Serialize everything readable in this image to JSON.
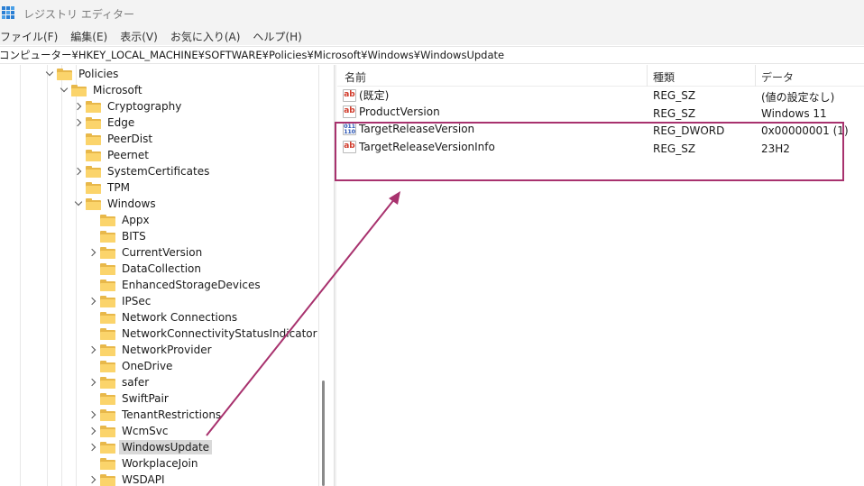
{
  "window": {
    "title": "レジストリ エディター"
  },
  "menu": [
    "ファイル(F)",
    "編集(E)",
    "表示(V)",
    "お気に入り(A)",
    "ヘルプ(H)"
  ],
  "address": "コンピューター¥HKEY_LOCAL_MACHINE¥SOFTWARE¥Policies¥Microsoft¥Windows¥WindowsUpdate",
  "tree": [
    {
      "label": "Policies",
      "expander": "down"
    },
    {
      "label": "Microsoft",
      "expander": "down"
    },
    {
      "label": "Cryptography",
      "expander": "right"
    },
    {
      "label": "Edge",
      "expander": "right"
    },
    {
      "label": "PeerDist",
      "expander": "none"
    },
    {
      "label": "Peernet",
      "expander": "none"
    },
    {
      "label": "SystemCertificates",
      "expander": "right"
    },
    {
      "label": "TPM",
      "expander": "none"
    },
    {
      "label": "Windows",
      "expander": "down"
    },
    {
      "label": "Appx",
      "expander": "none"
    },
    {
      "label": "BITS",
      "expander": "none"
    },
    {
      "label": "CurrentVersion",
      "expander": "right"
    },
    {
      "label": "DataCollection",
      "expander": "none"
    },
    {
      "label": "EnhancedStorageDevices",
      "expander": "none"
    },
    {
      "label": "IPSec",
      "expander": "right"
    },
    {
      "label": "Network Connections",
      "expander": "none"
    },
    {
      "label": "NetworkConnectivityStatusIndicator",
      "expander": "none"
    },
    {
      "label": "NetworkProvider",
      "expander": "right"
    },
    {
      "label": "OneDrive",
      "expander": "none"
    },
    {
      "label": "safer",
      "expander": "right"
    },
    {
      "label": "SwiftPair",
      "expander": "none"
    },
    {
      "label": "TenantRestrictions",
      "expander": "right"
    },
    {
      "label": "WcmSvc",
      "expander": "right"
    },
    {
      "label": "WindowsUpdate",
      "expander": "right",
      "selected": true
    },
    {
      "label": "WorkplaceJoin",
      "expander": "none"
    },
    {
      "label": "WSDAPI",
      "expander": "right"
    }
  ],
  "list": {
    "columns": [
      "名前",
      "種類",
      "データ"
    ],
    "rows": [
      {
        "icon": "string-value-icon",
        "name": "(既定)",
        "type": "REG_SZ",
        "data": "(値の設定なし)"
      },
      {
        "icon": "string-value-icon",
        "name": "ProductVersion",
        "type": "REG_SZ",
        "data": "Windows 11"
      },
      {
        "icon": "dword-value-icon",
        "name": "TargetReleaseVersion",
        "type": "REG_DWORD",
        "data": "0x00000001 (1)"
      },
      {
        "icon": "string-value-icon",
        "name": "TargetReleaseVersionInfo",
        "type": "REG_SZ",
        "data": "23H2"
      }
    ]
  },
  "colors": {
    "annotation": "#a8326e",
    "folder": "#fbd46b",
    "selection": "#d9d9d9"
  },
  "icon_glyphs": {
    "string": "ab",
    "dword": "011\n110"
  }
}
